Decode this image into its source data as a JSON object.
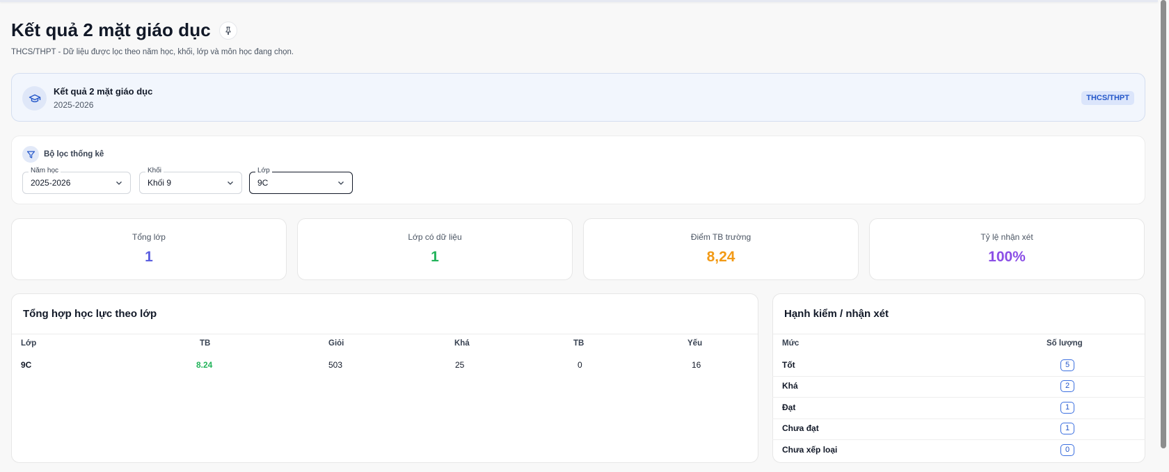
{
  "header": {
    "title": "Kết quả 2 mặt giáo dục",
    "subtitle": "THCS/THPT - Dữ liệu được lọc theo năm học, khối, lớp và môn học đang chọn."
  },
  "banner": {
    "title": "Kết quả 2 mặt giáo dục",
    "year": "2025-2026",
    "badge": "THCS/THPT"
  },
  "filters": {
    "heading": "Bộ lọc thống kê",
    "year": {
      "label": "Năm học",
      "value": "2025-2026"
    },
    "grade": {
      "label": "Khối",
      "value": "Khối 9"
    },
    "class": {
      "label": "Lớp",
      "value": "9C"
    }
  },
  "stats": [
    {
      "label": "Tổng lớp",
      "value": "1",
      "color": "#5b5fe0"
    },
    {
      "label": "Lớp có dữ liệu",
      "value": "1",
      "color": "#22b35a"
    },
    {
      "label": "Điểm TB trường",
      "value": "8,24",
      "color": "#f29a16"
    },
    {
      "label": "Tỷ lệ nhận xét",
      "value": "100%",
      "color": "#8b4fe6"
    }
  ],
  "academic": {
    "title": "Tổng hợp học lực theo lớp",
    "columns": [
      "Lớp",
      "TB",
      "Giỏi",
      "Khá",
      "TB",
      "Yếu"
    ],
    "rows": [
      {
        "class": "9C",
        "avg": "8.24",
        "gioi": "503",
        "kha": "25",
        "tb": "0",
        "yeu": "16"
      }
    ],
    "avg_color": "#22b35a"
  },
  "conduct": {
    "title": "Hạnh kiểm / nhận xét",
    "columns": [
      "Mức",
      "Số lượng"
    ],
    "rows": [
      {
        "level": "Tốt",
        "count": "5"
      },
      {
        "level": "Khá",
        "count": "2"
      },
      {
        "level": "Đạt",
        "count": "1"
      },
      {
        "level": "Chưa đạt",
        "count": "1"
      },
      {
        "level": "Chưa xếp loại",
        "count": "0"
      }
    ]
  },
  "icons": {
    "pin": "pin-icon",
    "graduation": "graduation-cap-icon",
    "filter": "filter-icon",
    "caret": "chevron-down-icon"
  }
}
